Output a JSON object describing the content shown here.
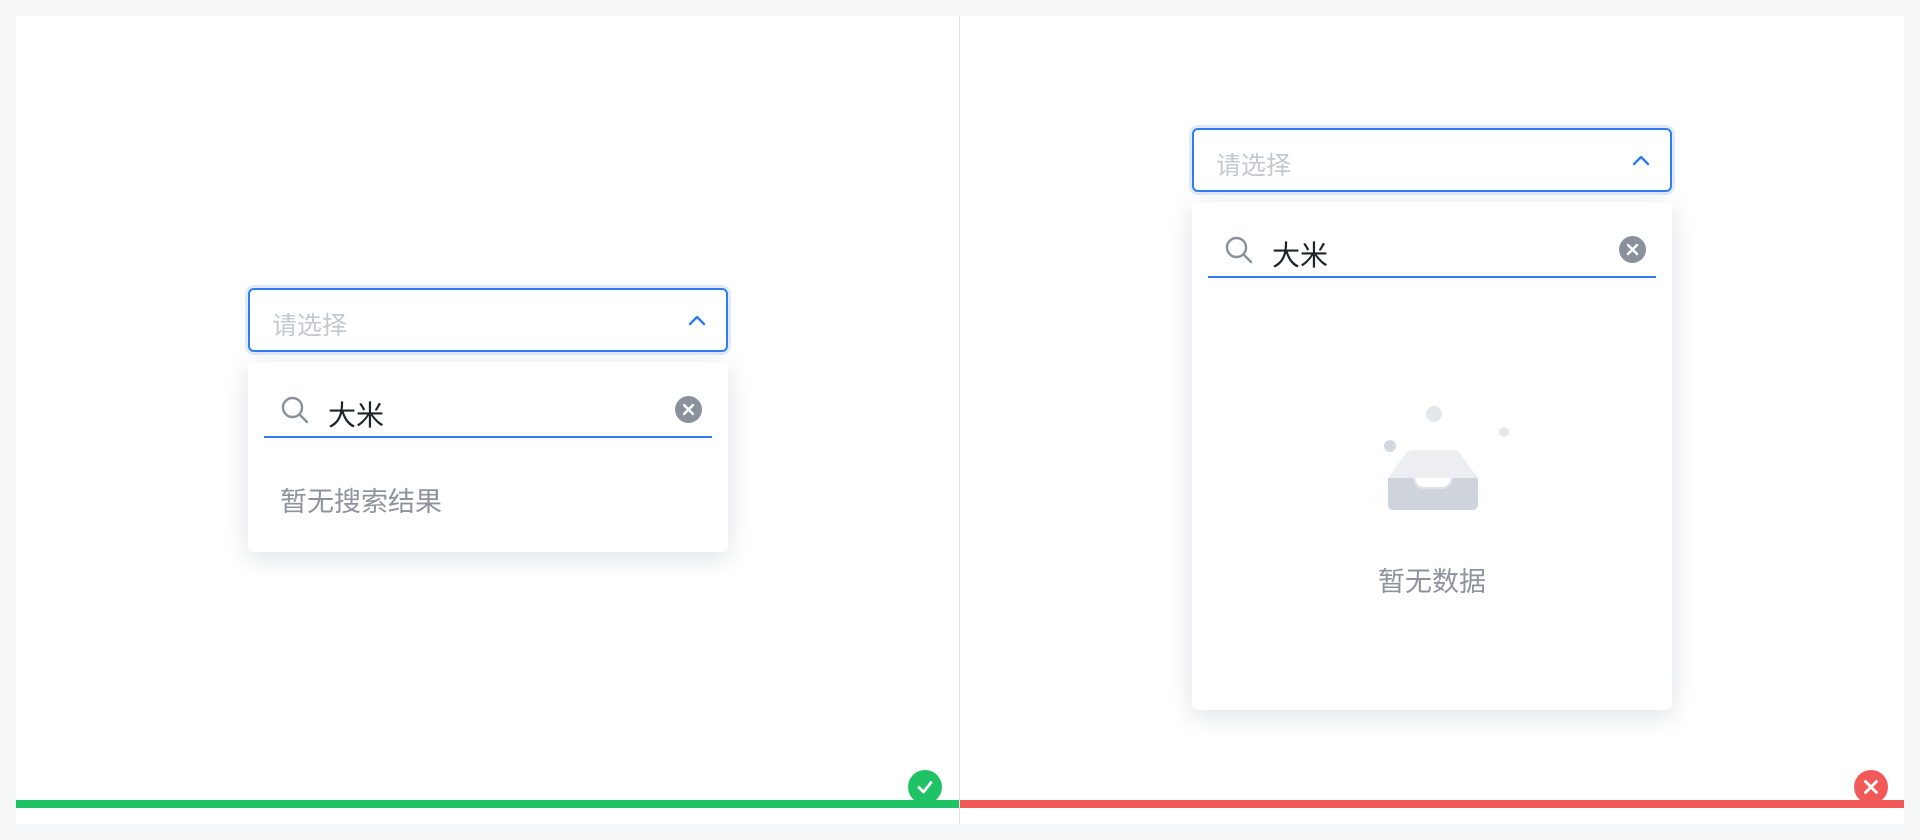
{
  "correct_example": {
    "select": {
      "placeholder": "请选择",
      "arrow_icon": "chevron-up-icon"
    },
    "dropdown": {
      "search_query": "大米",
      "search_icon": "search-icon",
      "clear_icon": "clear-circle-icon",
      "message": "暂无搜索结果"
    },
    "status": {
      "type": "correct",
      "icon": "check-circle-icon",
      "color": "#1fc264"
    }
  },
  "incorrect_example": {
    "select": {
      "placeholder": "请选择",
      "arrow_icon": "chevron-up-icon"
    },
    "dropdown": {
      "search_query": "大米",
      "search_icon": "search-icon",
      "clear_icon": "clear-circle-icon",
      "empty_illustration": "empty-inbox-illustration",
      "message": "暂无数据"
    },
    "status": {
      "type": "incorrect",
      "icon": "close-circle-icon",
      "color": "#f25a5a"
    }
  },
  "colors": {
    "accent": "#2f7bf5",
    "placeholder": "#c3c8d1",
    "muted_text": "#8d939e"
  }
}
